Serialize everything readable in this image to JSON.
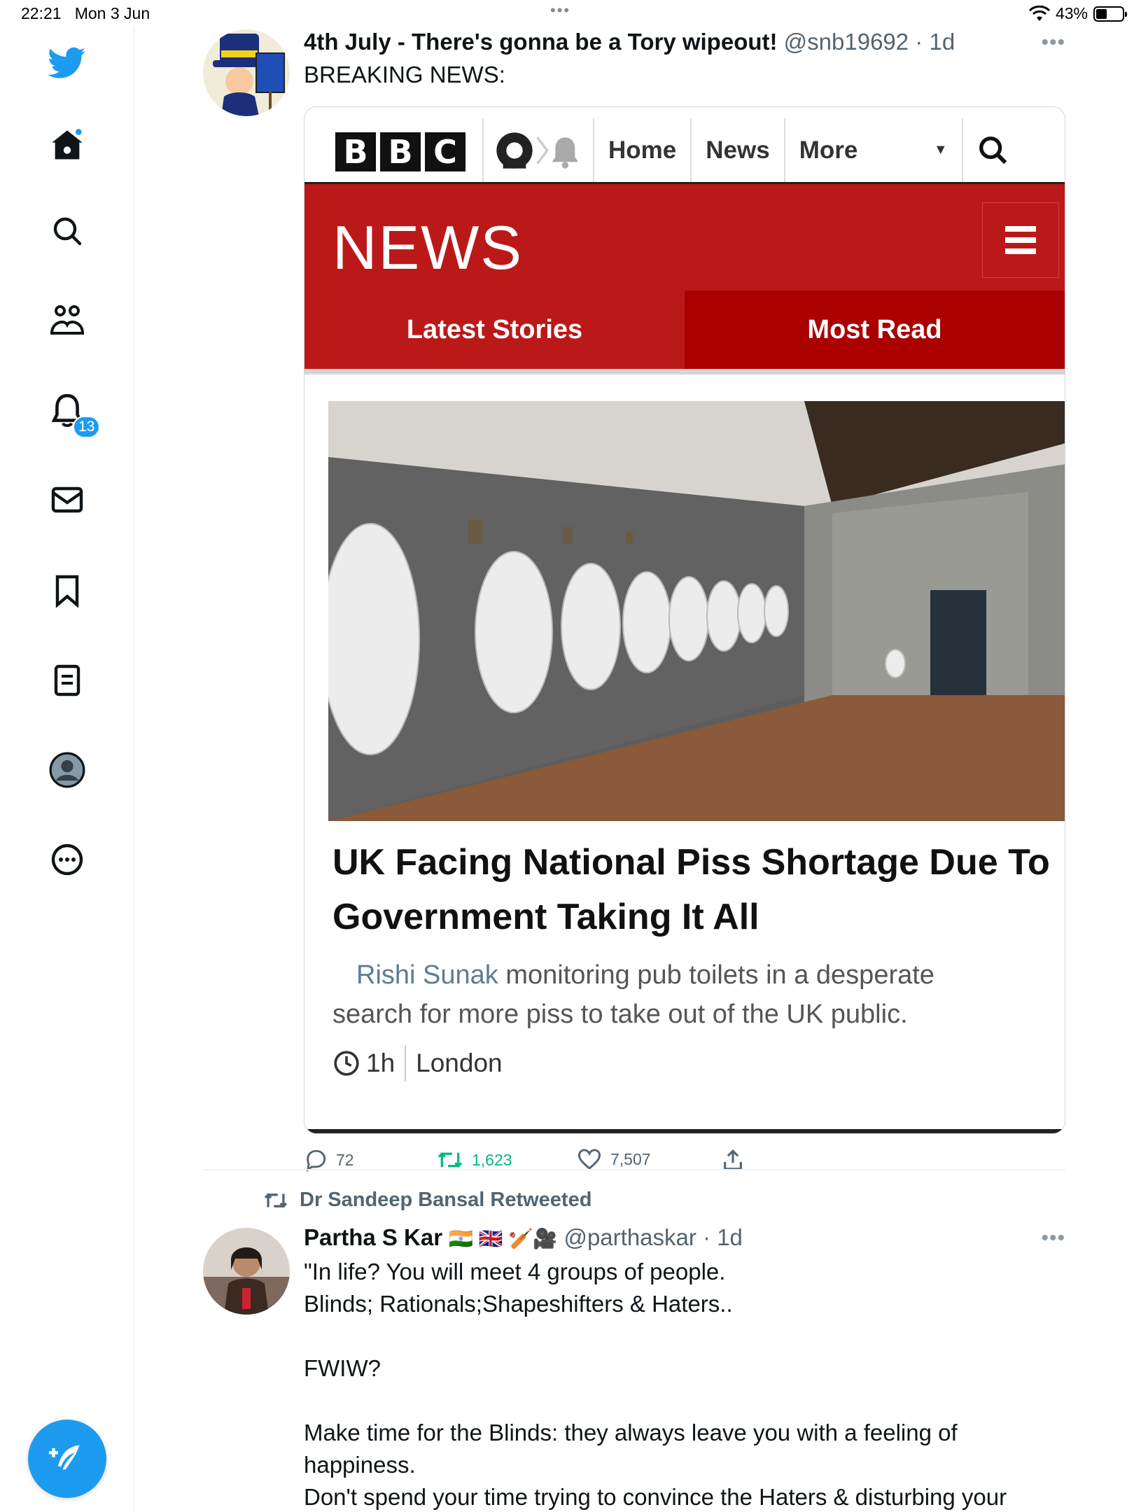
{
  "status_bar": {
    "time": "22:21",
    "date": "Mon 3 Jun",
    "battery": "43%",
    "battery_level": 0.43
  },
  "sidebar": {
    "notifications_badge": "13"
  },
  "tweet1": {
    "display_name": "4th July - There's gonna be a Tory wipeout!",
    "handle": "@snb19692",
    "time": "1d",
    "text": "BREAKING NEWS:",
    "media": {
      "logo_letters": [
        "B",
        "B",
        "C"
      ],
      "nav": [
        "Home",
        "News",
        "More"
      ],
      "banner": "NEWS",
      "tabs": [
        "Latest Stories",
        "Most Read"
      ],
      "headline": "UK Facing National Piss Shortage Due To Government Taking It All",
      "summary_name": "Rishi Sunak",
      "summary_rest": "monitoring pub toilets in a desperate search for more piss to take out of the UK public.",
      "age": "1h",
      "location": "London"
    },
    "replies": "72",
    "retweets": "1,623",
    "likes": "7,507"
  },
  "retweet_context": {
    "label": "Dr Sandeep Bansal Retweeted"
  },
  "tweet2": {
    "display_name": "Partha S Kar",
    "flags": "🇮🇳 🇬🇧 🏏🎥",
    "handle": "@parthaskar",
    "time": "1d",
    "text": "\"In life? You will meet 4 groups of people.\nBlinds; Rationals;Shapeshifters & Haters..\n\nFWIW?\n\nMake time for the Blinds: they always leave you with a feeling of happiness.\nDon't spend your time trying to convince the Haters & disturbing your"
  },
  "colors": {
    "twitter_blue": "#1d9bf0",
    "bbc_red": "#bb1919",
    "retweet_green": "#00ba7c"
  }
}
